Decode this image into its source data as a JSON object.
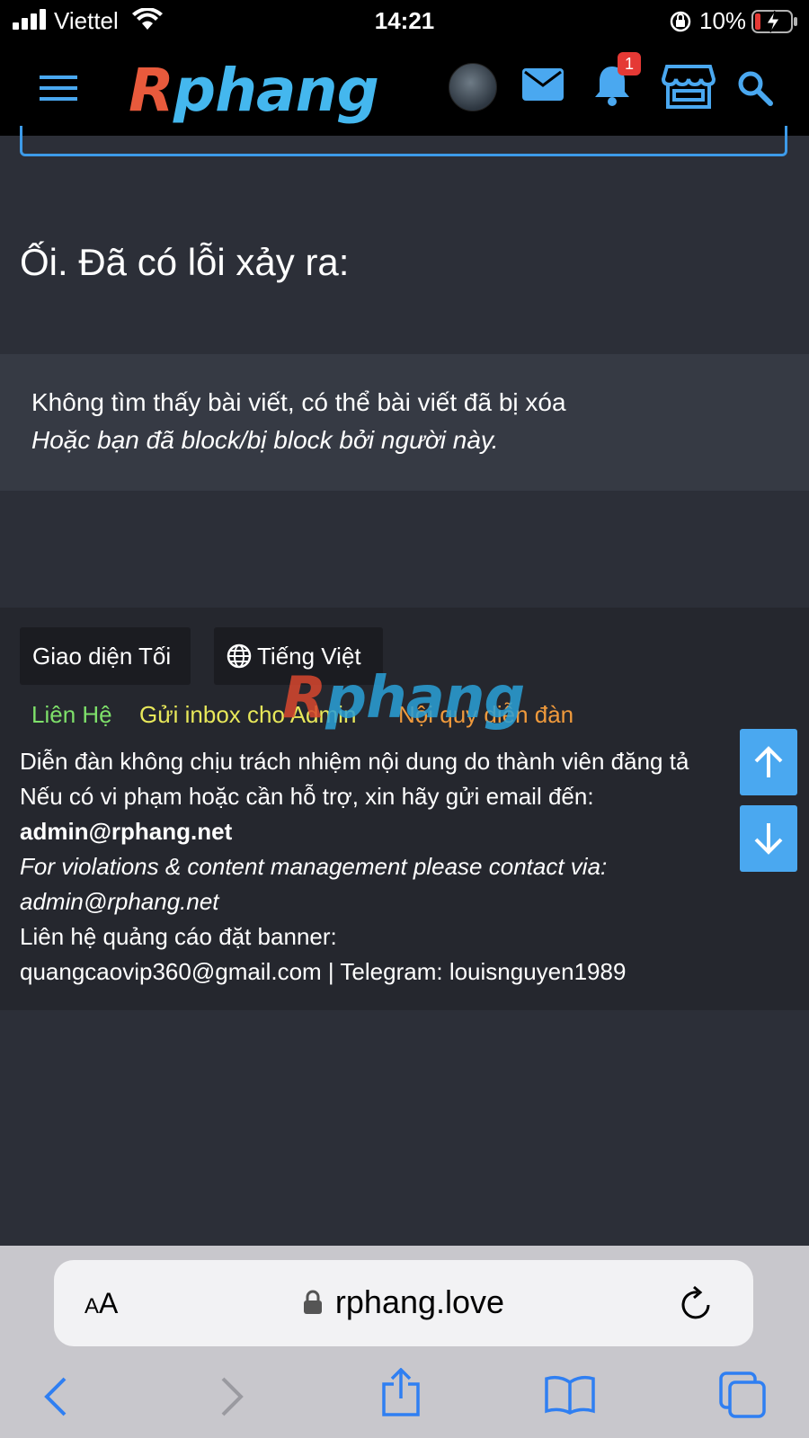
{
  "status_bar": {
    "carrier": "Viettel",
    "time": "14:21",
    "battery": "10%"
  },
  "header": {
    "logo_parts": [
      "R",
      "phang"
    ],
    "notification_count": "1",
    "icons": [
      "menu-icon",
      "avatar",
      "mail-icon",
      "bell-icon",
      "store-icon",
      "search-icon"
    ]
  },
  "main": {
    "error_title": "Ối. Đã có lỗi xảy ra:",
    "error_message": "Không tìm thấy bài viết, có thể bài viết đã bị xóa",
    "error_message_italic": "Hoặc bạn đã block/bị block bởi người này."
  },
  "footer": {
    "theme_button": "Giao diện Tối",
    "language_button": "Tiếng Việt",
    "links": [
      {
        "label": "Liên Hệ",
        "color": "#7ee06a"
      },
      {
        "label": "Gửi inbox cho Admin",
        "color": "#e8e85a"
      },
      {
        "label": "Nội quy diễn đàn",
        "color": "#f09a3c"
      }
    ],
    "watermark_parts": [
      "R",
      "phang"
    ],
    "disclaimer": "Diễn đàn không chịu trách nhiệm nội dung do thành viên đăng tả",
    "support_line": "Nếu có vi phạm hoặc cần hỗ trợ, xin hãy gửi email đến:",
    "support_email": "admin@rphang.net",
    "violations_line": "For violations & content management please contact via:",
    "violations_email": "admin@rphang.net",
    "ads_line": "Liên hệ quảng cáo đặt banner:",
    "ads_contact": "quangcaovip360@gmail.com | Telegram: louisnguyen1989"
  },
  "browser": {
    "text_size_label_small": "A",
    "text_size_label_large": "A",
    "url": "rphang.love"
  },
  "colors": {
    "accent": "#4aa8f0",
    "page_background": "#2c2f38",
    "footer_background": "#25272e"
  }
}
